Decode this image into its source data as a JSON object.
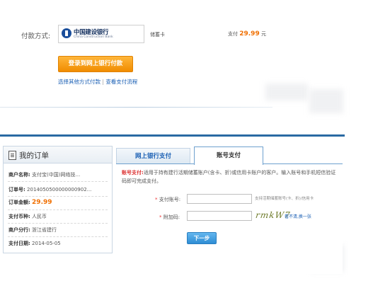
{
  "payment": {
    "method_label": "付款方式:",
    "bank_name_cn": "中国建设银行",
    "bank_name_en": "China Construction Bank",
    "card_type": "储蓄卡",
    "amount_prefix": "支付",
    "amount_value": "29.99",
    "amount_suffix": "元",
    "login_button": "登录到网上银行付款",
    "link_other": "选择其他方式付款",
    "link_separator": "|",
    "link_flow": "查看支付流程"
  },
  "order": {
    "title": "我的订单",
    "rows": [
      {
        "label": "商户名称:",
        "value": "支付宝(中国)网络技..."
      },
      {
        "label": "订单号:",
        "value": "2014050500000000902..."
      },
      {
        "label": "订单金额:",
        "value": "29.99"
      },
      {
        "label": "支付币种:",
        "value": "人民币"
      },
      {
        "label": "商户分行:",
        "value": "浙江省建行"
      },
      {
        "label": "支付日期:",
        "value": "2014-05-05"
      }
    ]
  },
  "tabs": [
    {
      "label": "网上银行支付"
    },
    {
      "label": "账号支付"
    }
  ],
  "account_pay": {
    "desc_title": "账号支付:",
    "desc_text": "适用于持有建行活期储蓄账户(含卡、折)或信用卡账户的客户。输入账号和手机短信验证码即可完成支付。",
    "account_label": "支付账号:",
    "account_hint": "支持活期储蓄账号(卡、折)/信用卡",
    "code_label": "附加码:",
    "captcha_text": "rmkW7",
    "refresh_text": "看不清,换一张",
    "star": "*",
    "next_button": "下一步"
  },
  "colors": {
    "accent_orange": "#f08c00",
    "link_blue": "#1a5fb4",
    "rule_blue": "#2a6aa3"
  }
}
